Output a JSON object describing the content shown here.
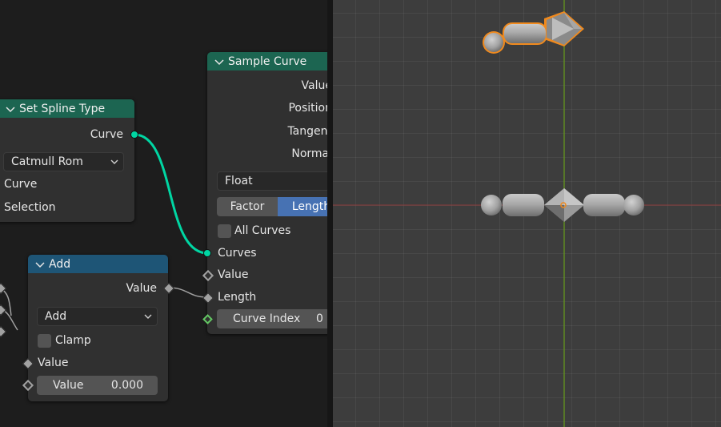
{
  "set_spline_node": {
    "title": "Set Spline Type",
    "output_curve": "Curve",
    "type_dropdown": "Catmull Rom",
    "input_curve": "Curve",
    "input_selection": "Selection",
    "header_color": "#1c6551"
  },
  "add_node": {
    "title": "Add",
    "output_value": "Value",
    "operation_dropdown": "Add",
    "clamp_label": "Clamp",
    "input_value": "Value",
    "value_field_label": "Value",
    "value_field_value": "0.000",
    "header_color": "#1e5576"
  },
  "sample_curve_node": {
    "title": "Sample Curve",
    "outputs": [
      "Value",
      "Position",
      "Tangent",
      "Normal"
    ],
    "data_type_dropdown": "Float",
    "mode_factor": "Factor",
    "mode_length": "Length",
    "mode_active": "Length",
    "all_curves_label": "All Curves",
    "input_curves": "Curves",
    "input_value": "Value",
    "input_length": "Length",
    "curve_index_label": "Curve Index",
    "curve_index_value": "0",
    "header_color": "#1c6551",
    "active_mode_color": "#4772b3"
  },
  "colors": {
    "geometry_socket": "#00d6a3",
    "float_socket": "#a1a1a1",
    "int_socket": "#63c763",
    "selection_outline": "#f08a1e",
    "x_axis": "#8a3a3a",
    "y_axis": "#5f8a22"
  }
}
